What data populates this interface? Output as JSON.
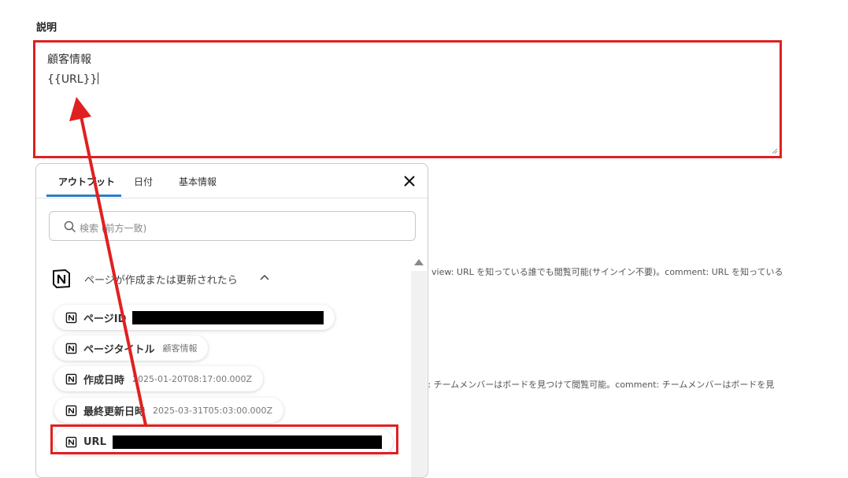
{
  "field": {
    "label": "説明",
    "value_lines": [
      "顧客情報",
      "{{URL}}"
    ]
  },
  "background_text": {
    "row1": "view: URL を知っている誰でも閲覧可能(サインイン不要)。comment: URL を知っている",
    "row2": "w: チームメンバーはボードを見つけて閲覧可能。comment: チームメンバーはボードを見"
  },
  "popup": {
    "tabs": [
      {
        "label": "アウトプット",
        "active": true
      },
      {
        "label": "日付",
        "active": false
      },
      {
        "label": "基本情報",
        "active": false
      }
    ],
    "close_icon": "close-icon",
    "search": {
      "placeholder": "検索 (前方一致)",
      "icon": "search-icon"
    },
    "section": {
      "title": "ページが作成または更新されたら",
      "icon": "notion-icon",
      "expanded": true
    },
    "items": [
      {
        "label": "ページID",
        "value": "",
        "redacted": true
      },
      {
        "label": "ページタイトル",
        "value": "顧客情報",
        "redacted": false
      },
      {
        "label": "作成日時",
        "value": "2025-01-20T08:17:00.000Z",
        "redacted": false
      },
      {
        "label": "最終更新日時",
        "value": "2025-03-31T05:03:00.000Z",
        "redacted": false
      },
      {
        "label": "URL",
        "value": "",
        "redacted": true
      }
    ]
  },
  "colors": {
    "highlight": "#e02020",
    "tab_accent": "#2f7cc8"
  }
}
